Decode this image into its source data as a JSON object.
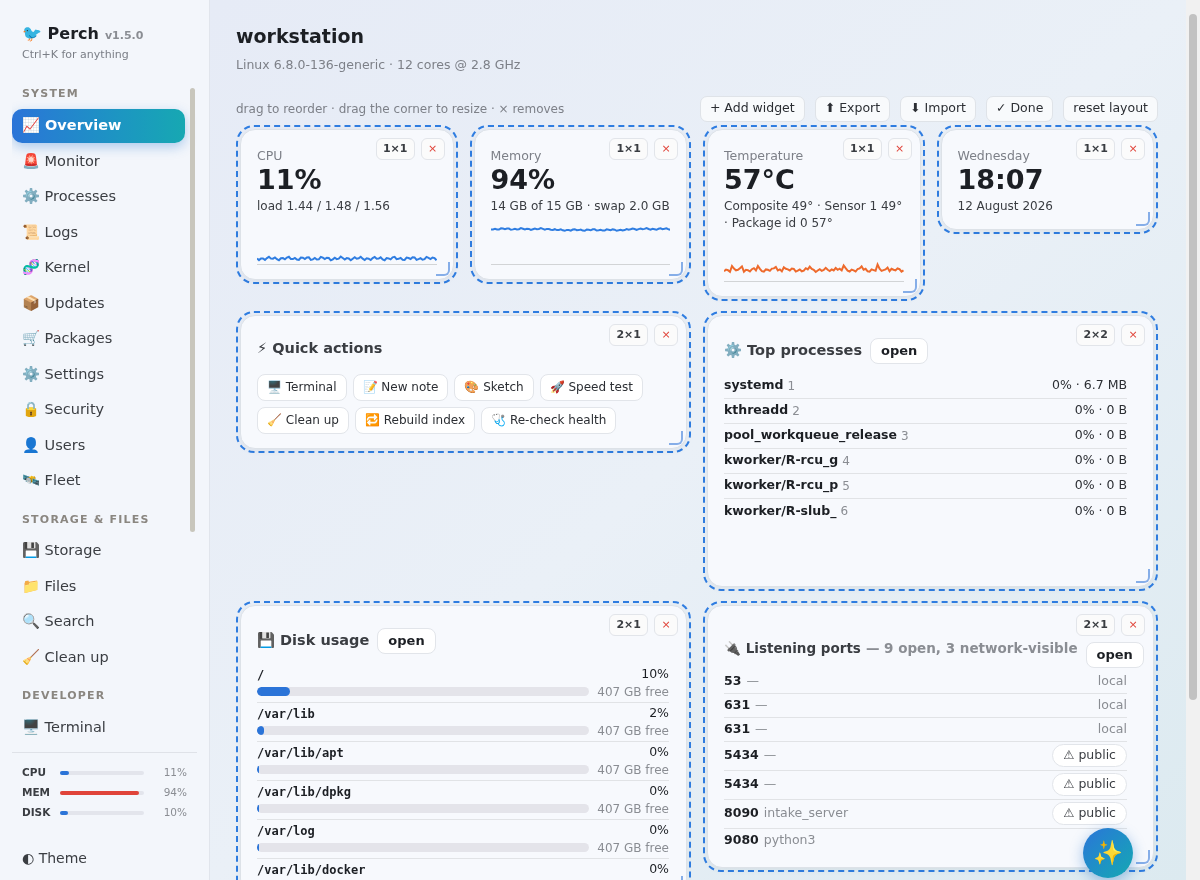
{
  "sidebar": {
    "brand": {
      "logo": "🐦",
      "name": "Perch",
      "version": "v1.5.0",
      "hint": "Ctrl+K for anything"
    },
    "sections": [
      {
        "heading": "SYSTEM",
        "items": [
          {
            "icon": "📈",
            "label": "Overview",
            "selected": true
          },
          {
            "icon": "🚨",
            "label": "Monitor",
            "selected": false
          },
          {
            "icon": "⚙️",
            "label": "Processes",
            "selected": false
          },
          {
            "icon": "📜",
            "label": "Logs",
            "selected": false
          },
          {
            "icon": "🧬",
            "label": "Kernel",
            "selected": false
          },
          {
            "icon": "📦",
            "label": "Updates",
            "selected": false
          },
          {
            "icon": "🛒",
            "label": "Packages",
            "selected": false
          },
          {
            "icon": "⚙️",
            "label": "Settings",
            "selected": false
          },
          {
            "icon": "🔒",
            "label": "Security",
            "selected": false
          },
          {
            "icon": "👤",
            "label": "Users",
            "selected": false
          },
          {
            "icon": "🛰️",
            "label": "Fleet",
            "selected": false
          }
        ]
      },
      {
        "heading": "STORAGE & FILES",
        "items": [
          {
            "icon": "💾",
            "label": "Storage",
            "selected": false
          },
          {
            "icon": "📁",
            "label": "Files",
            "selected": false
          },
          {
            "icon": "🔍",
            "label": "Search",
            "selected": false
          },
          {
            "icon": "🧹",
            "label": "Clean up",
            "selected": false
          }
        ]
      },
      {
        "heading": "DEVELOPER",
        "items": [
          {
            "icon": "🖥️",
            "label": "Terminal",
            "selected": false
          }
        ]
      }
    ],
    "meters": [
      {
        "label": "CPU",
        "level": 0.11,
        "reading": "11%"
      },
      {
        "label": "MEM",
        "level": 0.94,
        "reading": "94%"
      },
      {
        "label": "DISK",
        "level": 0.1,
        "reading": "10%"
      }
    ],
    "theme": {
      "icon": "◐",
      "label": "Theme"
    }
  },
  "header": {
    "title": "workstation",
    "subtitle": "Linux 6.8.0-136-generic · 12 cores @ 2.8 GHz",
    "hint": "drag to reorder · drag the corner to resize · × removes",
    "buttons": [
      "+ Add widget",
      "⬆ Export",
      "⬇ Import",
      "✓ Done",
      "reset layout"
    ]
  },
  "widgets": [
    {
      "kind": "stat",
      "label": "CPU",
      "value": "11%",
      "detail": "load 1.44 / 1.48 / 1.56",
      "size": "1×1",
      "close": "×",
      "color": "#2f7de1"
    },
    {
      "kind": "stat",
      "label": "Memory",
      "value": "94%",
      "detail": "14 GB of 15 GB · swap 2.0 GB",
      "size": "1×1",
      "close": "×",
      "color": "#2f7de1"
    },
    {
      "kind": "stat",
      "label": "Temperature",
      "value": "57°C",
      "detail": "Composite 49° · Sensor 1 49° · Package id 0 57°",
      "size": "1×1",
      "close": "×",
      "color": "#ee6a2c"
    },
    {
      "kind": "stat",
      "label": "Wednesday",
      "value": "18:07",
      "detail": "12 August 2026",
      "size": "1×1",
      "close": "×"
    },
    {
      "kind": "actions",
      "title": "⚡ Quick actions",
      "size": "2×1",
      "close": "×",
      "actions": [
        "🖥️ Terminal",
        "📝 New note",
        "🎨 Sketch",
        "🚀 Speed test",
        "🧹 Clean up",
        "🔁 Rebuild index",
        "🩺 Re-check health"
      ]
    },
    {
      "kind": "processes",
      "title": "⚙️ Top processes",
      "open": "open",
      "size": "2×2",
      "close": "×",
      "rows": [
        {
          "name": "systemd",
          "pid": "1",
          "usage": "0% · 6.7 MB"
        },
        {
          "name": "kthreadd",
          "pid": "2",
          "usage": "0% · 0 B"
        },
        {
          "name": "pool_workqueue_release",
          "pid": "3",
          "usage": "0% · 0 B"
        },
        {
          "name": "kworker/R-rcu_g",
          "pid": "4",
          "usage": "0% · 0 B"
        },
        {
          "name": "kworker/R-rcu_p",
          "pid": "5",
          "usage": "0% · 0 B"
        },
        {
          "name": "kworker/R-slub_",
          "pid": "6",
          "usage": "0% · 0 B"
        }
      ]
    },
    {
      "kind": "disk",
      "title": "💾 Disk usage",
      "open": "open",
      "size": "2×1",
      "close": "×",
      "rows": [
        {
          "path": "/",
          "percent": "10%",
          "level": 0.1,
          "free": "407 GB free"
        },
        {
          "path": "/var/lib",
          "percent": "2%",
          "level": 0.02,
          "free": "407 GB free"
        },
        {
          "path": "/var/lib/apt",
          "percent": "0%",
          "level": 0.0,
          "free": "407 GB free"
        },
        {
          "path": "/var/lib/dpkg",
          "percent": "0%",
          "level": 0.0,
          "free": "407 GB free"
        },
        {
          "path": "/var/log",
          "percent": "0%",
          "level": 0.0,
          "free": "407 GB free"
        },
        {
          "path": "/var/lib/docker",
          "percent": "0%"
        }
      ]
    },
    {
      "kind": "ports",
      "title": "🔌 Listening ports",
      "summary": "— 9 open, 3 network-visible",
      "open": "open",
      "size": "2×1",
      "close": "×",
      "rows": [
        {
          "port": "53",
          "process": "—",
          "kind": "local",
          "exposure": "local"
        },
        {
          "port": "631",
          "process": "—",
          "kind": "local",
          "exposure": "local"
        },
        {
          "port": "631",
          "process": "—",
          "kind": "local",
          "exposure": "local"
        },
        {
          "port": "5434",
          "process": "—",
          "kind": "public",
          "exposure": "⚠ public"
        },
        {
          "port": "5434",
          "process": "—",
          "kind": "public",
          "exposure": "⚠ public"
        },
        {
          "port": "8090",
          "process": "intake_server",
          "kind": "public",
          "exposure": "⚠ public"
        },
        {
          "port": "9080",
          "process": "python3"
        }
      ]
    }
  ],
  "assistant_button": "✨"
}
